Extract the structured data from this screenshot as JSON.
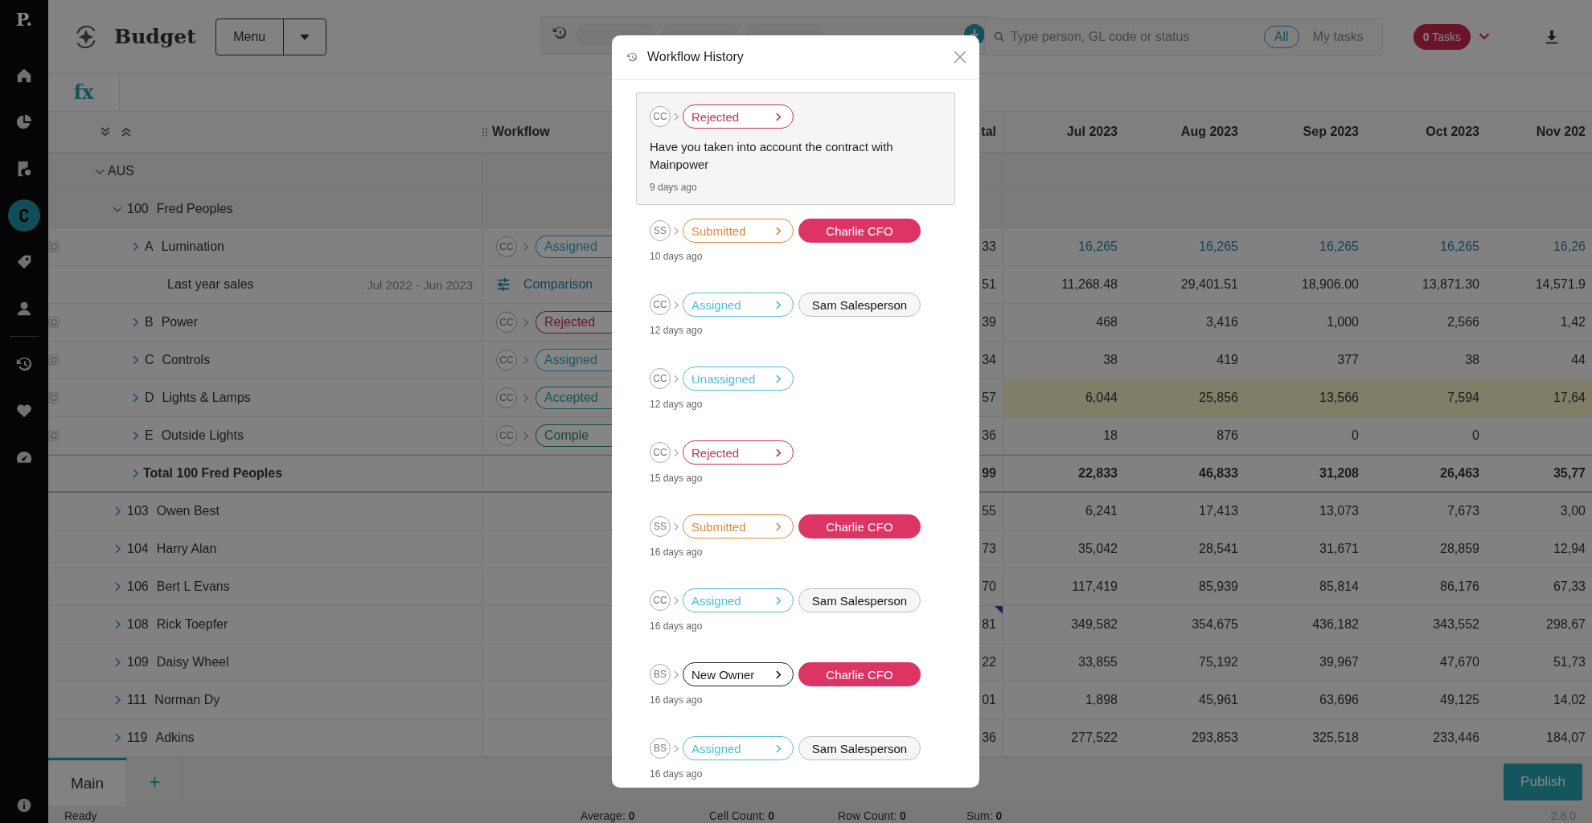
{
  "sidebar": {
    "logo": "P.",
    "primary": [
      {
        "kind": "home",
        "selected": false
      },
      {
        "kind": "pie-chart",
        "selected": false
      },
      {
        "kind": "invoice",
        "selected": false
      },
      {
        "kind": "loop",
        "selected": true
      },
      {
        "kind": "tag",
        "selected": false
      },
      {
        "kind": "person",
        "selected": false
      }
    ],
    "secondary": [
      {
        "kind": "history",
        "selected": false
      },
      {
        "kind": "heart",
        "selected": false
      },
      {
        "kind": "gauge",
        "selected": false
      }
    ]
  },
  "header": {
    "title": "Budget",
    "menu_button": "Menu",
    "search": {
      "placeholder": "Type person, GL code or status"
    },
    "scope": [
      {
        "label": "All",
        "selected": true
      },
      {
        "label": "My tasks",
        "selected": false
      }
    ],
    "tasks": "**0** Tasks"
  },
  "formula_bar": {
    "label": "fx"
  },
  "table": {
    "columns": [
      "Workflow",
      "tal",
      "Jul 2023",
      "Aug 2023",
      "Sep 2023",
      "Oct 2023",
      "Nov 202"
    ],
    "rows": [
      {
        "kind": "group",
        "label": "AUS",
        "expanded": true,
        "children": [
          {
            "kind": "group",
            "code": "100",
            "label": "Fred Peoples",
            "expanded": true,
            "children": [
              {
                "kind": "item",
                "code": "A",
                "label": "Lumination",
                "expanded": false,
                "editable": true,
                "highlighted": false,
                "flagged": false,
                "workflow": {
                  "avatar": "CC",
                  "status": "Assigned",
                  "kind": "assigned"
                },
                "total": "33",
                "months": [
                  "16,265",
                  "16,265",
                  "16,265",
                  "16,265",
                  "16,26"
                ]
              },
              {
                "kind": "comparison",
                "label": "Last year sales",
                "period": "Jul 2022 - Jun 2023",
                "editable": false,
                "highlighted": false,
                "flagged": false,
                "workflow": {
                  "label": "Comparison"
                },
                "total": "51",
                "months": [
                  "11,268.48",
                  "29,401.51",
                  "18,906.00",
                  "13,871.30",
                  "14,571.9"
                ]
              },
              {
                "kind": "item",
                "code": "B",
                "label": "Power",
                "expanded": false,
                "editable": false,
                "highlighted": false,
                "flagged": false,
                "workflow": {
                  "avatar": "CC",
                  "status": "Rejected",
                  "kind": "rejected"
                },
                "total": "39",
                "months": [
                  "468",
                  "3,416",
                  "1,000",
                  "2,566",
                  "1,42"
                ]
              },
              {
                "kind": "item",
                "code": "C",
                "label": "Controls",
                "expanded": false,
                "editable": false,
                "highlighted": false,
                "flagged": false,
                "workflow": {
                  "avatar": "CC",
                  "status": "Assigned",
                  "kind": "assigned"
                },
                "total": "34",
                "months": [
                  "38",
                  "419",
                  "377",
                  "38",
                  "44"
                ]
              },
              {
                "kind": "item",
                "code": "D",
                "label": "Lights & Lamps",
                "expanded": false,
                "editable": false,
                "highlighted": true,
                "flagged": false,
                "workflow": {
                  "avatar": "CC",
                  "status": "Accepted",
                  "kind": "accepted"
                },
                "total": "57",
                "months": [
                  "6,044",
                  "25,856",
                  "13,566",
                  "7,594",
                  "17,64"
                ]
              },
              {
                "kind": "item",
                "code": "E",
                "label": "Outside Lights",
                "expanded": false,
                "editable": false,
                "highlighted": false,
                "flagged": false,
                "workflow": {
                  "avatar": "CC",
                  "status": "Comple",
                  "kind": "completed"
                },
                "total": "36",
                "months": [
                  "18",
                  "876",
                  "0",
                  "0"
                ]
              },
              {
                "kind": "total",
                "label": "Total 100 Fred Peoples",
                "expanded": false,
                "editable": false,
                "highlighted": false,
                "flagged": false,
                "total": "99",
                "months": [
                  "22,833",
                  "46,833",
                  "31,208",
                  "26,463",
                  "35,77"
                ]
              }
            ]
          },
          {
            "kind": "person",
            "code": "103",
            "label": "Owen Best",
            "expanded": false,
            "editable": false,
            "highlighted": false,
            "flagged": false,
            "total": "55",
            "months": [
              "6,241",
              "17,413",
              "13,073",
              "7,673",
              "3,00"
            ]
          },
          {
            "kind": "person",
            "code": "104",
            "label": "Harry Alan",
            "expanded": false,
            "editable": false,
            "highlighted": false,
            "flagged": false,
            "total": "73",
            "months": [
              "35,042",
              "28,541",
              "31,671",
              "28,859",
              "12,94"
            ]
          },
          {
            "kind": "person",
            "code": "106",
            "label": "Bert L Evans",
            "expanded": false,
            "editable": false,
            "highlighted": false,
            "flagged": false,
            "total": "70",
            "months": [
              "117,419",
              "85,939",
              "85,814",
              "86,176",
              "67,33"
            ]
          },
          {
            "kind": "person",
            "code": "108",
            "label": "Rick Toepfer",
            "expanded": false,
            "editable": false,
            "highlighted": false,
            "flagged": true,
            "total": "81",
            "months": [
              "349,582",
              "354,675",
              "436,182",
              "343,552",
              "298,67"
            ]
          },
          {
            "kind": "person",
            "code": "109",
            "label": "Daisy Wheel",
            "expanded": false,
            "editable": false,
            "highlighted": false,
            "flagged": false,
            "total": "22",
            "months": [
              "33,855",
              "75,192",
              "39,967",
              "47,670",
              "51,73"
            ]
          },
          {
            "kind": "person",
            "code": "111",
            "label": "Norman Dy",
            "expanded": false,
            "editable": false,
            "highlighted": false,
            "flagged": false,
            "total": "01",
            "months": [
              "1,898",
              "45,961",
              "63,696",
              "49,125",
              "14,02"
            ]
          },
          {
            "kind": "person",
            "code": "119",
            "label": "Adkins",
            "expanded": false,
            "editable": false,
            "highlighted": false,
            "flagged": false,
            "total": "36",
            "months": [
              "277,522",
              "293,853",
              "325,518",
              "233,446",
              "184,07"
            ]
          }
        ]
      }
    ]
  },
  "sheet_tabs": [
    {
      "label": "Main",
      "selected": true
    }
  ],
  "add_tab": "+",
  "publish_button": "Publish",
  "status_bar": {
    "state": "Ready",
    "stats": [
      "Average: **0**",
      "Cell Count: **0**",
      "Row Count: **0**",
      "Sum: **0**"
    ],
    "version": "2.8.0"
  },
  "dialog": {
    "title": "Workflow History",
    "entries": [
      {
        "avatar": "CC",
        "status": "Rejected",
        "color": "#c8334f",
        "selected": true,
        "comment": "Have you taken into account the contract with Mainpower",
        "time": "9 days ago"
      },
      {
        "avatar": "SS",
        "status": "Submitted",
        "color": "#e0883a",
        "selected": false,
        "assignee": {
          "name": "Charlie CFO",
          "kind": "highlight"
        },
        "time": "10 days ago"
      },
      {
        "avatar": "CC",
        "status": "Assigned",
        "color": "#4cbdd6",
        "selected": false,
        "assignee": {
          "name": "Sam Salesperson",
          "kind": "plain"
        },
        "time": "12 days ago"
      },
      {
        "avatar": "CC",
        "status": "Unassigned",
        "color": "#4cbdd6",
        "selected": false,
        "time": "12 days ago"
      },
      {
        "avatar": "CC",
        "status": "Rejected",
        "color": "#c8334f",
        "selected": false,
        "time": "15 days ago"
      },
      {
        "avatar": "SS",
        "status": "Submitted",
        "color": "#e0883a",
        "selected": false,
        "assignee": {
          "name": "Charlie CFO",
          "kind": "highlight"
        },
        "time": "16 days ago"
      },
      {
        "avatar": "CC",
        "status": "Assigned",
        "color": "#4cbdd6",
        "selected": false,
        "assignee": {
          "name": "Sam Salesperson",
          "kind": "plain"
        },
        "time": "16 days ago"
      },
      {
        "avatar": "BS",
        "status": "New Owner",
        "color": "#222222",
        "selected": false,
        "assignee": {
          "name": "Charlie CFO",
          "kind": "highlight"
        },
        "time": "16 days ago"
      },
      {
        "avatar": "BS",
        "status": "Assigned",
        "color": "#4cbdd6",
        "selected": false,
        "assignee": {
          "name": "Sam Salesperson",
          "kind": "plain"
        },
        "time": "16 days ago"
      }
    ]
  }
}
